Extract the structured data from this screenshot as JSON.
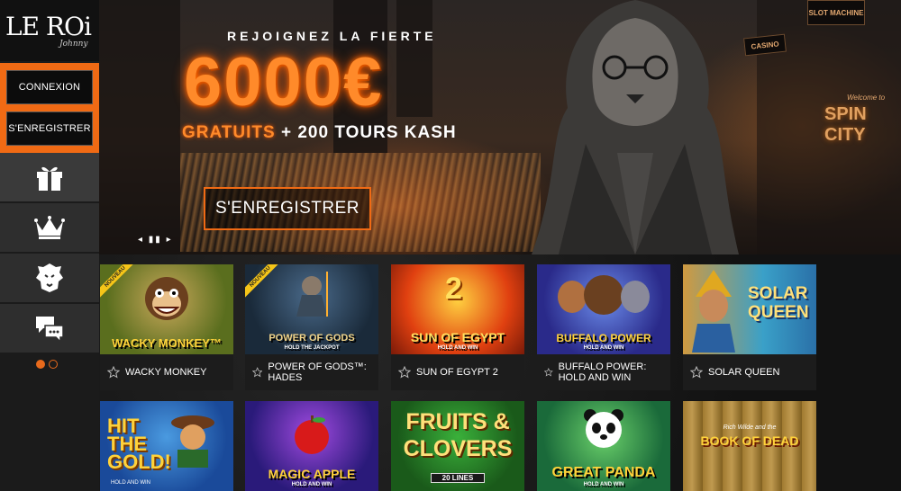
{
  "logo": {
    "main": "LE ROi",
    "sub": "Johnny"
  },
  "auth": {
    "login_label": "CONNEXION",
    "register_label": "S'ENREGISTRER"
  },
  "sidebar_icons": [
    "gift-icon",
    "crown-icon",
    "lion-icon",
    "chat-icon"
  ],
  "pager": {
    "pages": 2,
    "active": 1
  },
  "banner": {
    "subtitle": "REJOIGNEZ LA FIERTE",
    "amount": "6000€",
    "offer_highlight": "GRATUITS",
    "offer_rest": " + 200 TOURS KASH",
    "cta_label": "S'ENREGISTRER",
    "slider_controls": "◂ ▮▮ ▸",
    "signs": {
      "slot": "SLOT MACHINE",
      "casino": "CASINO",
      "spin": "SPIN CITY",
      "welcome": "Welcome to"
    }
  },
  "ribbon_label": "NOUVEAU",
  "games": [
    {
      "name": "WACKY MONKEY",
      "art": "WACKY MONKEY™",
      "badge": true
    },
    {
      "name": "POWER OF GODS™: HADES",
      "art": "POWER OF GODS",
      "art_sub": "HOLD THE JACKPOT",
      "badge": true
    },
    {
      "name": "SUN OF EGYPT 2",
      "art": "SUN OF EGYPT",
      "art_sub": "HOLD AND WIN",
      "badge": false
    },
    {
      "name": "BUFFALO POWER: HOLD AND WIN",
      "art": "BUFFALO POWER",
      "art_sub": "HOLD AND WIN",
      "badge": false
    },
    {
      "name": "SOLAR QUEEN",
      "art": "SOLAR QUEEN",
      "badge": false
    },
    {
      "art": "HIT THE GOLD!",
      "art_sub": "HOLD AND WIN"
    },
    {
      "art": "MAGIC APPLE",
      "art_sub": "HOLD AND WIN"
    },
    {
      "art": "FRUITS & CLOVERS",
      "art_sub": "20 LINES"
    },
    {
      "art": "GREAT PANDA",
      "art_sub": "HOLD AND WIN"
    },
    {
      "art": "BOOK OF DEAD",
      "art_sub": "Rich Wilde and the"
    }
  ]
}
